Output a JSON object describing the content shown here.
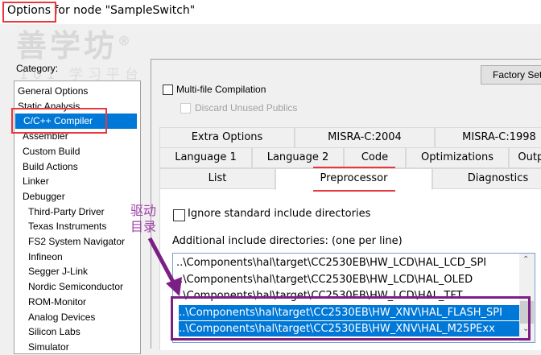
{
  "window": {
    "title_prefix": "Options",
    "title_rest": " for node \"SampleSwitch\""
  },
  "watermark": {
    "brand": "善学坊",
    "sub": "101 学习平台",
    "mark": "®"
  },
  "category": {
    "label": "Category:",
    "items": [
      {
        "label": "General Options",
        "level": 0
      },
      {
        "label": "Static Analysis",
        "level": 0
      },
      {
        "label": "C/C++ Compiler",
        "level": 1,
        "selected": true
      },
      {
        "label": "Assembler",
        "level": 1
      },
      {
        "label": "Custom Build",
        "level": 1
      },
      {
        "label": "Build Actions",
        "level": 1
      },
      {
        "label": "Linker",
        "level": 1
      },
      {
        "label": "Debugger",
        "level": 1
      },
      {
        "label": "Third-Party Driver",
        "level": 2
      },
      {
        "label": "Texas Instruments",
        "level": 2
      },
      {
        "label": "FS2 System Navigator",
        "level": 2
      },
      {
        "label": "Infineon",
        "level": 2
      },
      {
        "label": "Segger J-Link",
        "level": 2
      },
      {
        "label": "Nordic Semiconductor",
        "level": 2
      },
      {
        "label": "ROM-Monitor",
        "level": 2
      },
      {
        "label": "Analog Devices",
        "level": 2
      },
      {
        "label": "Silicon Labs",
        "level": 2
      },
      {
        "label": "Simulator",
        "level": 2
      }
    ]
  },
  "factory_button": "Factory Settings",
  "multi_file": {
    "label": "Multi-file Compilation",
    "checked": false
  },
  "discard": {
    "label": "Discard Unused Publics",
    "checked": false,
    "disabled": true
  },
  "tabs": {
    "row1": [
      "Extra Options",
      "MISRA-C:2004",
      "MISRA-C:1998"
    ],
    "row2": [
      "Language 1",
      "Language 2",
      "Code",
      "Optimizations",
      "Output"
    ],
    "row3": [
      "List",
      "Preprocessor",
      "Diagnostics"
    ],
    "active": "Preprocessor"
  },
  "ignore_std": {
    "label": "Ignore standard include directories",
    "checked": false
  },
  "include_dirs": {
    "label": "Additional include directories: (one per line)",
    "lines": [
      {
        "text": "..\\Components\\hal\\target\\CC2530EB\\HW_LCD\\HAL_LCD_SPI",
        "selected": false
      },
      {
        "text": "..\\Components\\hal\\target\\CC2530EB\\HW_LCD\\HAL_OLED",
        "selected": false
      },
      {
        "text": "..\\Components\\hal\\target\\CC2530EB\\HW_LCD\\HAL_TFT",
        "selected": false
      },
      {
        "text": "..\\Components\\hal\\target\\CC2530EB\\HW_XNV\\HAL_FLASH_SPI",
        "selected": true
      },
      {
        "text": "..\\Components\\hal\\target\\CC2530EB\\HW_XNV\\HAL_M25PExx",
        "selected": true
      }
    ]
  },
  "annotation": {
    "text": "驱动目录",
    "color": "#a040a8"
  },
  "colors": {
    "highlight": "#0078d7",
    "red_box": "#e8383d",
    "purple_box": "#7b1f86"
  }
}
